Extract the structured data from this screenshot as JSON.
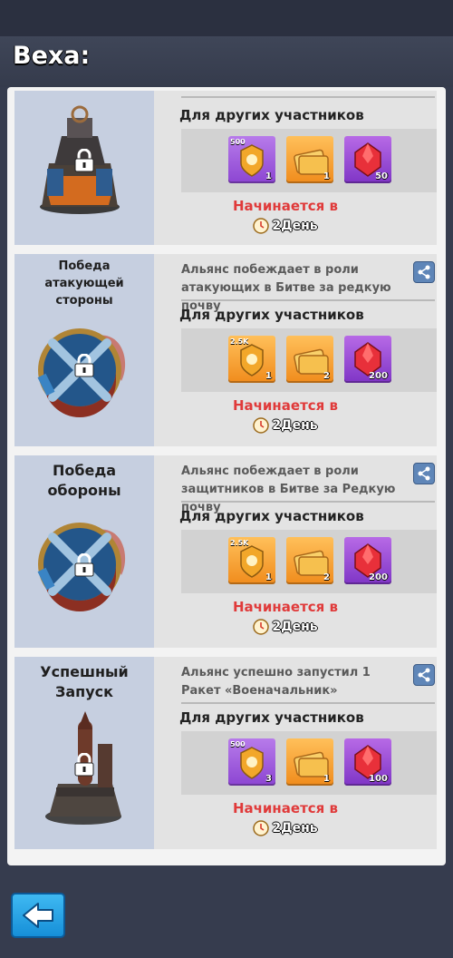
{
  "header": {
    "title": "Веха:"
  },
  "cards": [
    {
      "name": "",
      "art_icon": "tower-icon",
      "description": "",
      "for_label": "Для других участников",
      "rewards": [
        {
          "icon": "badge-icon",
          "cap": "500",
          "count": "1",
          "color": "purple"
        },
        {
          "icon": "ticket-icon",
          "cap": "",
          "count": "1",
          "color": "orange"
        },
        {
          "icon": "gem-icon",
          "cap": "",
          "count": "50",
          "color": "purple"
        }
      ],
      "starts_label": "Начинается в",
      "day_label": "2День"
    },
    {
      "name": "Победа атакующей стороны",
      "art_icon": "shield-emblem-icon",
      "description": "Альянс побеждает в роли атакующих в Битве за редкую почву",
      "for_label": "Для других участников",
      "rewards": [
        {
          "icon": "badge-icon",
          "cap": "2.5K",
          "count": "1",
          "color": "orange"
        },
        {
          "icon": "ticket-icon",
          "cap": "",
          "count": "2",
          "color": "orange"
        },
        {
          "icon": "gem-icon",
          "cap": "",
          "count": "200",
          "color": "purple"
        }
      ],
      "starts_label": "Начинается в",
      "day_label": "2День"
    },
    {
      "name": "Победа обороны",
      "art_icon": "shield-emblem-icon",
      "description": "Альянс побеждает в роли защитников в Битве за Редкую почву",
      "for_label": "Для других участников",
      "rewards": [
        {
          "icon": "badge-icon",
          "cap": "2.5K",
          "count": "1",
          "color": "orange"
        },
        {
          "icon": "ticket-icon",
          "cap": "",
          "count": "2",
          "color": "orange"
        },
        {
          "icon": "gem-icon",
          "cap": "",
          "count": "200",
          "color": "purple"
        }
      ],
      "starts_label": "Начинается в",
      "day_label": "2День"
    },
    {
      "name": "Успешный Запуск",
      "art_icon": "missile-launcher-icon",
      "description": "Альянс успешно запустил 1 Ракет «Военачальник»",
      "for_label": "Для других участников",
      "rewards": [
        {
          "icon": "badge-icon",
          "cap": "500",
          "count": "3",
          "color": "purple"
        },
        {
          "icon": "ticket-icon",
          "cap": "",
          "count": "1",
          "color": "orange"
        },
        {
          "icon": "gem-icon",
          "cap": "",
          "count": "100",
          "color": "purple"
        }
      ],
      "starts_label": "Начинается в",
      "day_label": "2День"
    }
  ]
}
